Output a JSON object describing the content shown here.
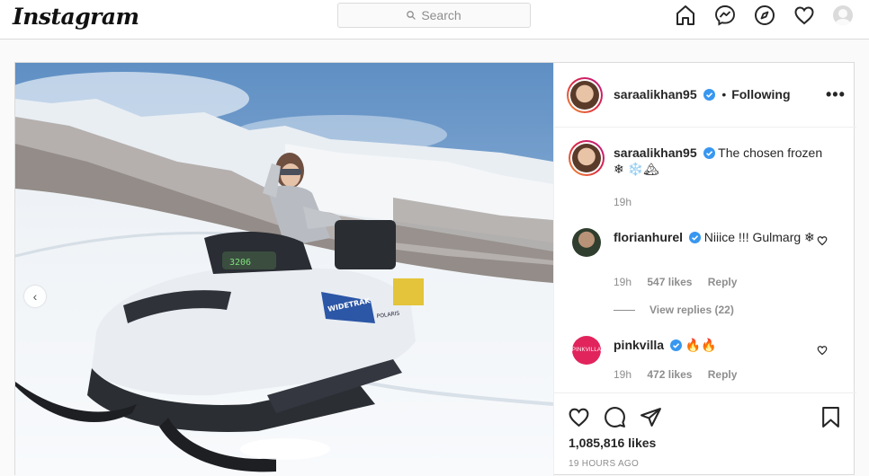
{
  "nav": {
    "logo": "Instagram",
    "search_placeholder": "Search",
    "icons": [
      "home-icon",
      "messenger-icon",
      "explore-icon",
      "activity-heart-icon",
      "profile-avatar"
    ]
  },
  "post": {
    "author": {
      "username": "saraalikhan95",
      "separator": "•",
      "follow_status": "Following"
    },
    "more_label": "•••",
    "caption": {
      "username": "saraalikhan95",
      "text": "The chosen frozen ❄ ❄️🏔",
      "time": "19h"
    },
    "comments": [
      {
        "username": "florianhurel",
        "text": "Niiice !!! Gulmarg ❄",
        "time": "19h",
        "likes": "547 likes",
        "reply": "Reply",
        "view_replies": "View replies (22)"
      },
      {
        "username": "pinkvilla",
        "avatar_text": "PINKVILLA",
        "text": "🔥🔥",
        "time": "19h",
        "likes": "472 likes",
        "reply": "Reply"
      }
    ],
    "likes_count": "1,085,816 likes",
    "posted_ago": "19 HOURS AGO",
    "prev_arrow": "‹",
    "snowmobile_text": {
      "plate": "3206",
      "model": "WIDETRAK",
      "brand": "POLARIS"
    }
  },
  "colors": {
    "verified_blue": "#3897f0",
    "border": "#dbdbdb",
    "muted": "#8e8e8e",
    "pinkvilla": "#e2245c"
  }
}
